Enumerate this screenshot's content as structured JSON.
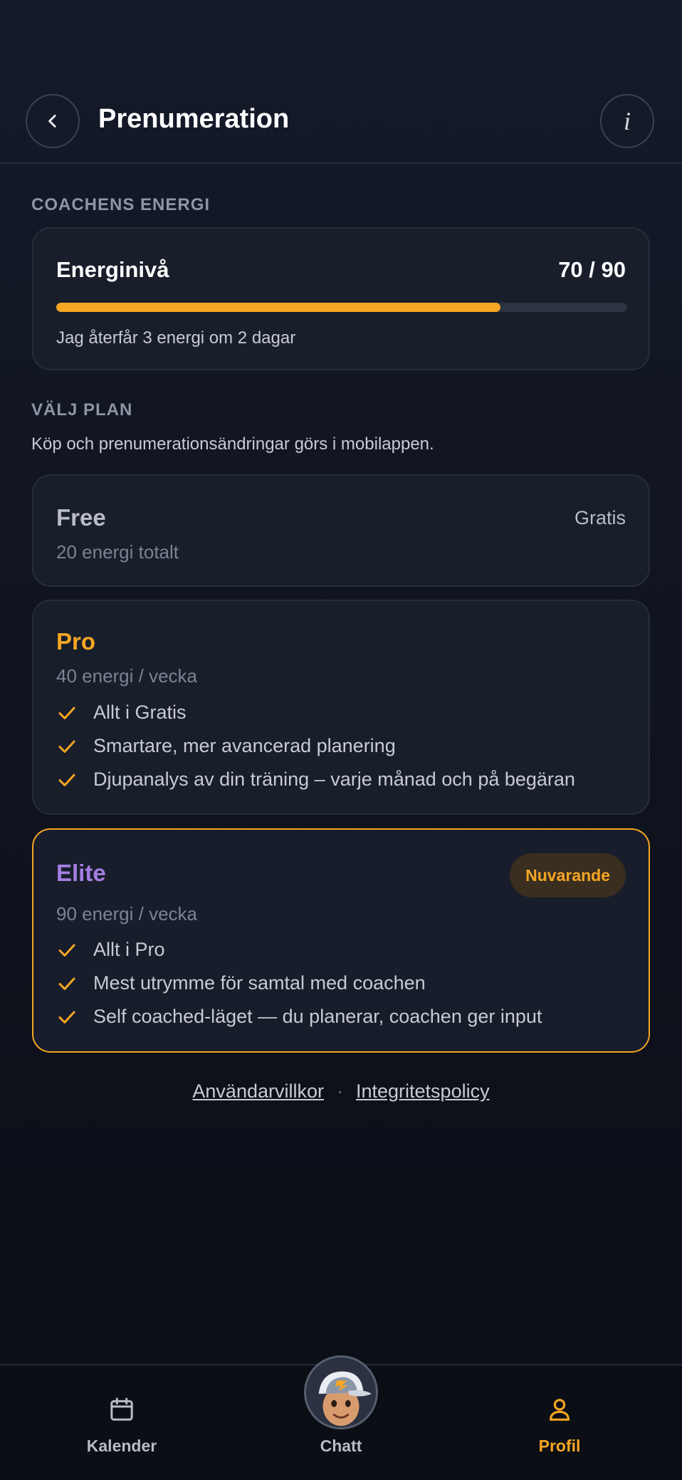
{
  "header": {
    "title": "Prenumeration",
    "info_label": "i"
  },
  "energy": {
    "section_label": "COACHENS ENERGI",
    "title": "Energinivå",
    "value_text": "70 / 90",
    "progress_fraction": 0.778,
    "note": "Jag återfår 3 energi om 2 dagar"
  },
  "plans": {
    "section_label": "VÄLJ PLAN",
    "subtitle": "Köp och prenumerationsändringar görs i mobilappen.",
    "free": {
      "name": "Free",
      "price": "Gratis",
      "energy": "20 energi totalt"
    },
    "pro": {
      "name": "Pro",
      "energy": "40 energi / vecka",
      "features": [
        "Allt i Gratis",
        "Smartare, mer avancerad planering",
        "Djupanalys av din träning – varje månad och på begäran"
      ]
    },
    "elite": {
      "name": "Elite",
      "badge": "Nuvarande",
      "energy": "90 energi / vecka",
      "features": [
        "Allt i Pro",
        "Mest utrymme för samtal med coachen",
        "Self coached-läget — du planerar, coachen ger input"
      ]
    }
  },
  "links": {
    "terms": "Användarvillkor",
    "separator": "·",
    "privacy": "Integritetspolicy"
  },
  "tabbar": {
    "calendar": "Kalender",
    "chat": "Chatt",
    "profile": "Profil"
  },
  "colors": {
    "accent": "#f5a623",
    "pro": "#f5a623",
    "elite": "#a47ee0",
    "free": "#b8bcc6"
  },
  "icons": {
    "back": "chevron-left-icon",
    "info": "info-icon",
    "check": "check-icon",
    "calendar": "calendar-icon",
    "profile": "user-icon"
  }
}
